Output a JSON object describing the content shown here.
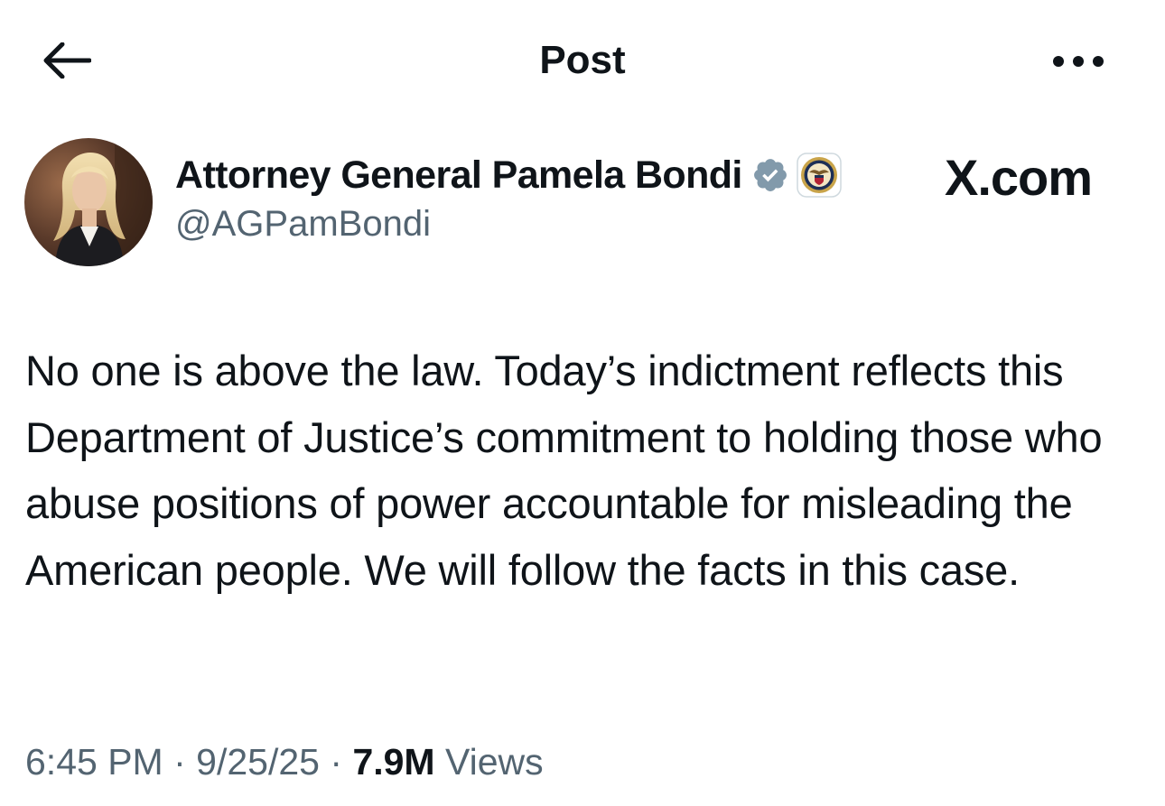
{
  "header": {
    "title": "Post",
    "back_icon": "arrow-left-icon",
    "more_icon": "more-horizontal-icon"
  },
  "author": {
    "display_name": "Attorney General Pamela Bondi",
    "handle": "@AGPamBondi",
    "verified_badge_icon": "verified-badge-icon",
    "verified_badge_color": "#829aab",
    "affiliation_badge_icon": "department-of-justice-seal-icon",
    "avatar_icon": "profile-photo"
  },
  "watermark": {
    "text": "X.com"
  },
  "post": {
    "text": "No one is above the law. Today’s indictment reflects this Department of Justice’s commitment to holding those who abuse positions of power accountable for misleading the American people. We will follow the facts in this case."
  },
  "meta": {
    "time": "6:45 PM",
    "separator": "·",
    "date": "9/25/25",
    "views_count": "7.9M",
    "views_label": "Views"
  },
  "colors": {
    "text_primary": "#0f1419",
    "text_secondary": "#536471",
    "background": "#ffffff"
  }
}
